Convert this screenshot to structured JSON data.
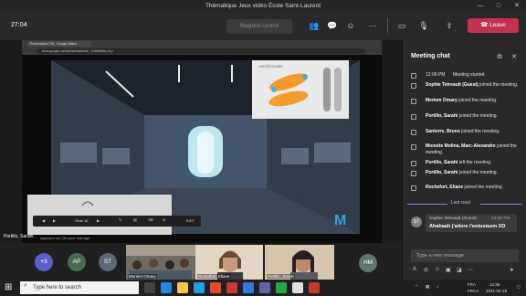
{
  "window": {
    "title": "Thématique Jeux vidéo École Saint-Laurent",
    "minimize": "—",
    "maximize": "□",
    "close": "✕"
  },
  "toolbar": {
    "timer": "27:04",
    "request_control": "Request control",
    "leave_label": "Leave",
    "icons": [
      "people-icon",
      "chat-icon",
      "reactions-icon",
      "more-icon",
      "camera-icon",
      "mic-icon",
      "share-icon"
    ]
  },
  "browser": {
    "tab_title": "Présentation TW - Google Slides",
    "address": "docs.google.com/presentation/d/…/edit#slide=id.p"
  },
  "slide": {
    "brand": "M",
    "board_caption": "HOVER BOARD"
  },
  "presenter": {
    "name": "Portillo, Sarahi",
    "caption_hint": "Appuyez sur Ctrl pour interagir"
  },
  "slide_controls": {
    "page": "Slide 16",
    "exit": "EXIT"
  },
  "strip": {
    "overflow": "+3",
    "avatars": [
      "AP",
      "ST",
      "HM"
    ],
    "tiles": [
      {
        "label": "Meriem Omary"
      },
      {
        "label": "Rochefort, Éliane"
      },
      {
        "label": "Portillo, Sarahi"
      }
    ]
  },
  "chat": {
    "title": "Meeting chat",
    "messages": [
      {
        "time": "12:08 PM",
        "text": "Meeting started"
      },
      {
        "name": "Sophie Tetreault (Guest)",
        "text": "joined the meeting."
      },
      {
        "name": "Meriem Omary",
        "text": "joined the meeting."
      },
      {
        "name": "Portillo, Sarahi",
        "text": "joined the meeting."
      },
      {
        "name": "Santerre, Bruno",
        "text": "joined the meeting."
      },
      {
        "name": "Monette Molina, Marc-Alexandre",
        "text": "joined the meeting."
      },
      {
        "name": "Portillo, Sarahi",
        "text": "left the meeting."
      },
      {
        "name": "Portillo, Sarahi",
        "text": "joined the meeting."
      },
      {
        "name": "Rochefort, Eliane",
        "text": "joined the meeting."
      }
    ],
    "last_read": "Last read",
    "post": {
      "author": "Sophie Tetreault (Guest)",
      "time": "12:02 PM",
      "text": "Ahahaah j'adore l'entusiasm XD",
      "initials": "ST"
    },
    "compose_placeholder": "Type a new message"
  },
  "taskbar": {
    "search_placeholder": "Type here to search",
    "lang": "FRA",
    "locale": "FRCA",
    "time": "12:35",
    "date": "2021-02-18"
  },
  "colors": {
    "leave": "#c4314b",
    "accent": "#7b83eb",
    "chat_bg": "#292929"
  }
}
